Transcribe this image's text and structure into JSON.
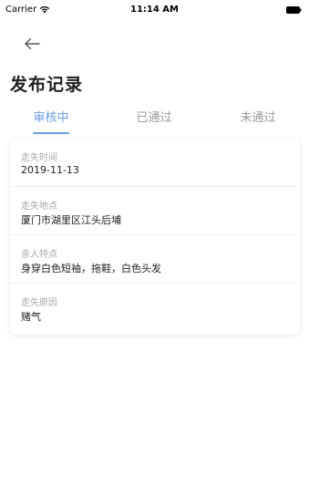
{
  "status_bar": {
    "carrier": "Carrier",
    "time": "11:14 AM"
  },
  "header": {
    "back_icon": "arrow-left-icon",
    "title": "发布记录"
  },
  "tabs": [
    {
      "label": "审核中",
      "active": true
    },
    {
      "label": "已通过",
      "active": false
    },
    {
      "label": "未通过",
      "active": false
    }
  ],
  "record": {
    "fields": [
      {
        "label": "走失时间",
        "value": "2019-11-13"
      },
      {
        "label": "走失地点",
        "value": "厦门市湖里区江头后埔"
      },
      {
        "label": "亲人特点",
        "value": "身穿白色短袖，拖鞋，白色头发"
      },
      {
        "label": "走失原因",
        "value": "赌气"
      }
    ]
  },
  "colors": {
    "accent": "#6a9de6",
    "inactive_tab": "#9a9a9a",
    "label_gray": "#a8a8a8"
  }
}
